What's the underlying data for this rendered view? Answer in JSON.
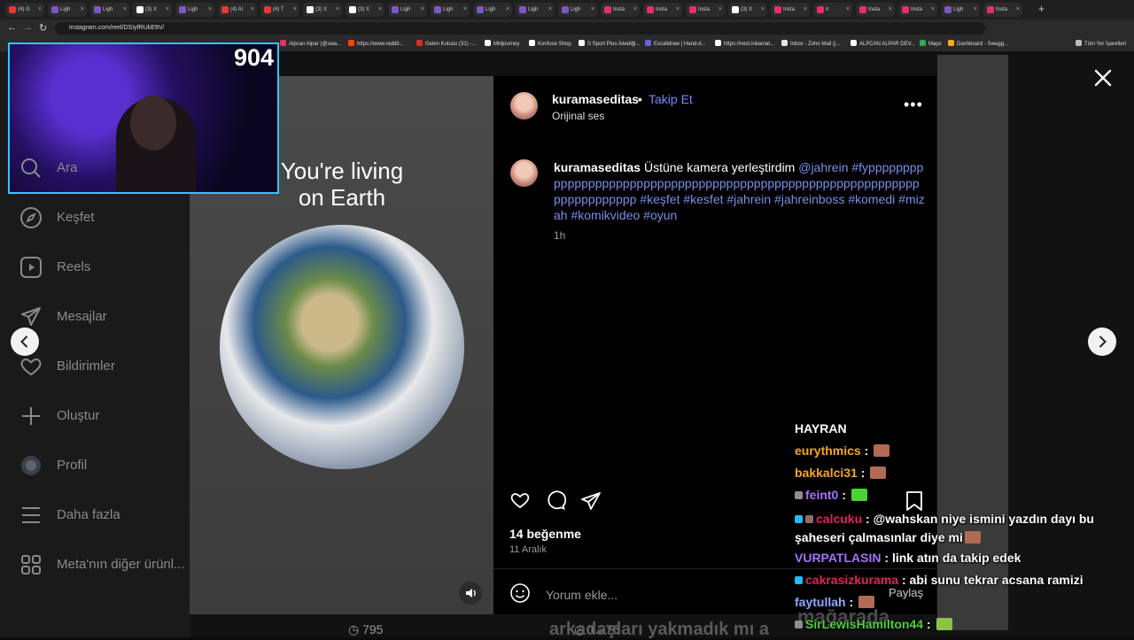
{
  "browser": {
    "tabs": [
      {
        "label": "(4) G",
        "color": "#e53935"
      },
      {
        "label": "Ligh",
        "color": "#7e57c2"
      },
      {
        "label": "Ligh",
        "color": "#7e57c2"
      },
      {
        "label": "(3) X",
        "color": "#ffffff"
      },
      {
        "label": "Ligh",
        "color": "#7e57c2"
      },
      {
        "label": "(4) Al",
        "color": "#e53935"
      },
      {
        "label": "(4) T",
        "color": "#e53935"
      },
      {
        "label": "(3) X",
        "color": "#ffffff"
      },
      {
        "label": "(3) X",
        "color": "#ffffff"
      },
      {
        "label": "Ligh",
        "color": "#7e57c2"
      },
      {
        "label": "Ligh",
        "color": "#7e57c2"
      },
      {
        "label": "Ligh",
        "color": "#7e57c2"
      },
      {
        "label": "Ligh",
        "color": "#7e57c2"
      },
      {
        "label": "Ligh",
        "color": "#7e57c2"
      },
      {
        "label": "Insta",
        "color": "#e1306c"
      },
      {
        "label": "Insta",
        "color": "#e1306c"
      },
      {
        "label": "Insta",
        "color": "#e1306c"
      },
      {
        "label": "(3) X",
        "color": "#ffffff"
      },
      {
        "label": "Insta",
        "color": "#e1306c"
      },
      {
        "label": "Ir",
        "color": "#e1306c"
      },
      {
        "label": "Insta",
        "color": "#e1306c"
      },
      {
        "label": "Insta",
        "color": "#e1306c"
      },
      {
        "label": "Ligh",
        "color": "#7e57c2"
      },
      {
        "label": "Insta",
        "color": "#e1306c"
      }
    ],
    "url": "instagram.com/reel/DSIyfRUkE9V/",
    "bookmarks": [
      {
        "label": "Alpcan Alpar (@swa...",
        "color": "#e1306c"
      },
      {
        "label": "https://www.reddit...",
        "color": "#ff4500"
      },
      {
        "label": "Gelen Kutusu (31) -...",
        "color": "#d93025"
      },
      {
        "label": "Midjourney",
        "color": "#ffffff"
      },
      {
        "label": "Konfuse Shop",
        "color": "#ffffff"
      },
      {
        "label": "S Sport Plus-İstediği...",
        "color": "#ffffff"
      },
      {
        "label": "Excalidraw | Hand-d...",
        "color": "#6965db"
      },
      {
        "label": "https://next.inkamat...",
        "color": "#ffffff"
      },
      {
        "label": "Inbox - Zoho Mail (j...",
        "color": "#e8e8e8"
      },
      {
        "label": "ALPCAN ALPAR DEV...",
        "color": "#ffffff"
      },
      {
        "label": "Maps",
        "color": "#34a853"
      },
      {
        "label": "Dashboard - Swagg...",
        "color": "#f9a825"
      }
    ],
    "all_bookmarks": "Tüm Yer İşaretleri"
  },
  "sidebar": {
    "items": [
      {
        "label": "Ara",
        "icon": "search-icon"
      },
      {
        "label": "Keşfet",
        "icon": "compass-icon"
      },
      {
        "label": "Reels",
        "icon": "reels-icon"
      },
      {
        "label": "Mesajlar",
        "icon": "messages-icon"
      },
      {
        "label": "Bildirimler",
        "icon": "heart-icon"
      },
      {
        "label": "Oluştur",
        "icon": "plus-icon"
      },
      {
        "label": "Profil",
        "icon": "profile-avatar"
      },
      {
        "label": "Daha fazla",
        "icon": "menu-icon"
      },
      {
        "label": "Meta'nın diğer ürünl...",
        "icon": "apps-icon"
      }
    ]
  },
  "video": {
    "overlay_text_line1": "You're living",
    "overlay_text_line2": "on Earth"
  },
  "post": {
    "username": "kuramaseditas",
    "separator": "•",
    "follow_label": "Takip Et",
    "audio": "Orijinal ses",
    "caption_user": "kuramaseditas",
    "caption_text": "Üstüne kamera yerleştirdim",
    "caption_mention": "@jahrein",
    "caption_tags": "#fyppppppppppppppppppppppppppppppppppppppppppppppppppppppppppppppppppppppppp #keşfet #kesfet #jahrein #jahreinboss #komedi #mizah #komikvideo #oyun",
    "time_ago": "1h",
    "likes": "14 beğenme",
    "date": "11 Aralık",
    "comment_placeholder": "Yorum ekle..."
  },
  "stream": {
    "viewer_count": "904",
    "chat_title": "HAYRAN",
    "chat": [
      {
        "user": "eurythmics",
        "color": "#f5a623",
        "message": "",
        "emote": "#b06a55",
        "badges": []
      },
      {
        "user": "bakkalci31",
        "color": "#f5a623",
        "message": "",
        "emote": "#b06a55",
        "badges": []
      },
      {
        "user": "feint0",
        "color": "#a770ff",
        "message": "",
        "emote": "#4cd137",
        "badges": [
          "#8e8e8e"
        ]
      },
      {
        "user": "calcuku",
        "color": "#e0245e",
        "message": "@wahskan niye ismini yazdın dayı bu şaheseri çalmasınlar diye mi",
        "emote": "#b06a55",
        "badges": [
          "#29b6f6",
          "#8d6e63"
        ]
      },
      {
        "user": "VURPATLASIN",
        "color": "#a770ff",
        "message": "link atın da takip edek",
        "emote": "",
        "badges": []
      },
      {
        "user": "cakrasizkurama",
        "color": "#e0245e",
        "message": "abi sunu tekrar acsana ramizi",
        "emote": "",
        "badges": [
          "#29b6f6"
        ]
      },
      {
        "user": "faytullah",
        "color": "#8fa8ff",
        "message": "",
        "emote": "#b06a55",
        "badges": []
      },
      {
        "user": "SirLewisHamilton44",
        "color": "#4cd137",
        "message": "",
        "emote": "#8bc34a",
        "badges": [
          "#8e8e8e"
        ]
      }
    ]
  },
  "background": {
    "views_left": "795",
    "views_right": "1.276",
    "share_label": "Paylaş",
    "bottom_text": "arkadaşları yakmadık mı a",
    "bottom_text_right": "mağarada"
  }
}
